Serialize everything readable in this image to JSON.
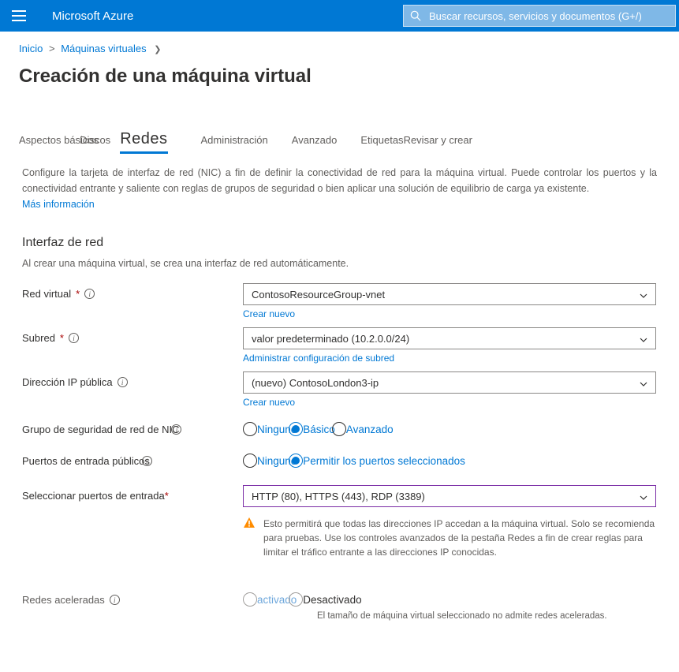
{
  "brand": "Microsoft Azure",
  "search": {
    "placeholder": "Buscar recursos, servicios y documentos (G+/)"
  },
  "breadcrumb": {
    "home": "Inicio",
    "vms": "Máquinas virtuales"
  },
  "title": "Creación de una máquina virtual",
  "tabs": {
    "basics": "Aspectos básicos",
    "disks": "Discos",
    "networking": "Redes",
    "management": "Administración",
    "advanced": "Avanzado",
    "tags": "Etiquetas",
    "review": "Revisar y crear"
  },
  "description": "Configure la tarjeta de interfaz de red (NIC) a fin de definir la conectividad de red para la máquina virtual. Puede controlar los puertos y la conectividad entrante y saliente con reglas de grupos de seguridad o bien aplicar una solución de equilibrio de carga ya existente.",
  "more_info": "Más información",
  "section": {
    "heading": "Interfaz de red",
    "sub": "Al crear una máquina virtual, se crea una interfaz de red automáticamente."
  },
  "fields": {
    "vnet": {
      "label": "Red virtual",
      "value": "ContosoResourceGroup-vnet",
      "sublink": "Crear nuevo"
    },
    "subnet": {
      "label": "Subred",
      "value": "valor predeterminado (10.2.0.0/24)",
      "sublink": "Administrar configuración de subred"
    },
    "publicip": {
      "label": "Dirección IP pública",
      "value": "(nuevo) ContosoLondon3-ip",
      "sublink": "Crear nuevo"
    },
    "nsg": {
      "label": "Grupo de seguridad de red de NIC",
      "options": {
        "none": "Ninguno",
        "basic": "Básico",
        "advanced": "Avanzado"
      }
    },
    "inbound": {
      "label": "Puertos de entrada públicos",
      "options": {
        "none": "Ninguno",
        "allow": "Permitir los puertos seleccionados"
      }
    },
    "ports": {
      "label": "Seleccionar puertos de entrada",
      "value": "HTTP (80), HTTPS (443), RDP (3389)"
    },
    "warning": "Esto permitirá que todas las direcciones IP accedan a la máquina virtual. Solo se recomienda para pruebas. Use los controles avanzados de la pestaña Redes a fin de crear reglas para limitar el tráfico entrante a las direcciones IP conocidas.",
    "accel": {
      "label": "Redes aceleradas",
      "options": {
        "on": "activado",
        "off": "Desactivado"
      },
      "note": "El tamaño de máquina virtual seleccionado no admite redes aceleradas."
    }
  }
}
